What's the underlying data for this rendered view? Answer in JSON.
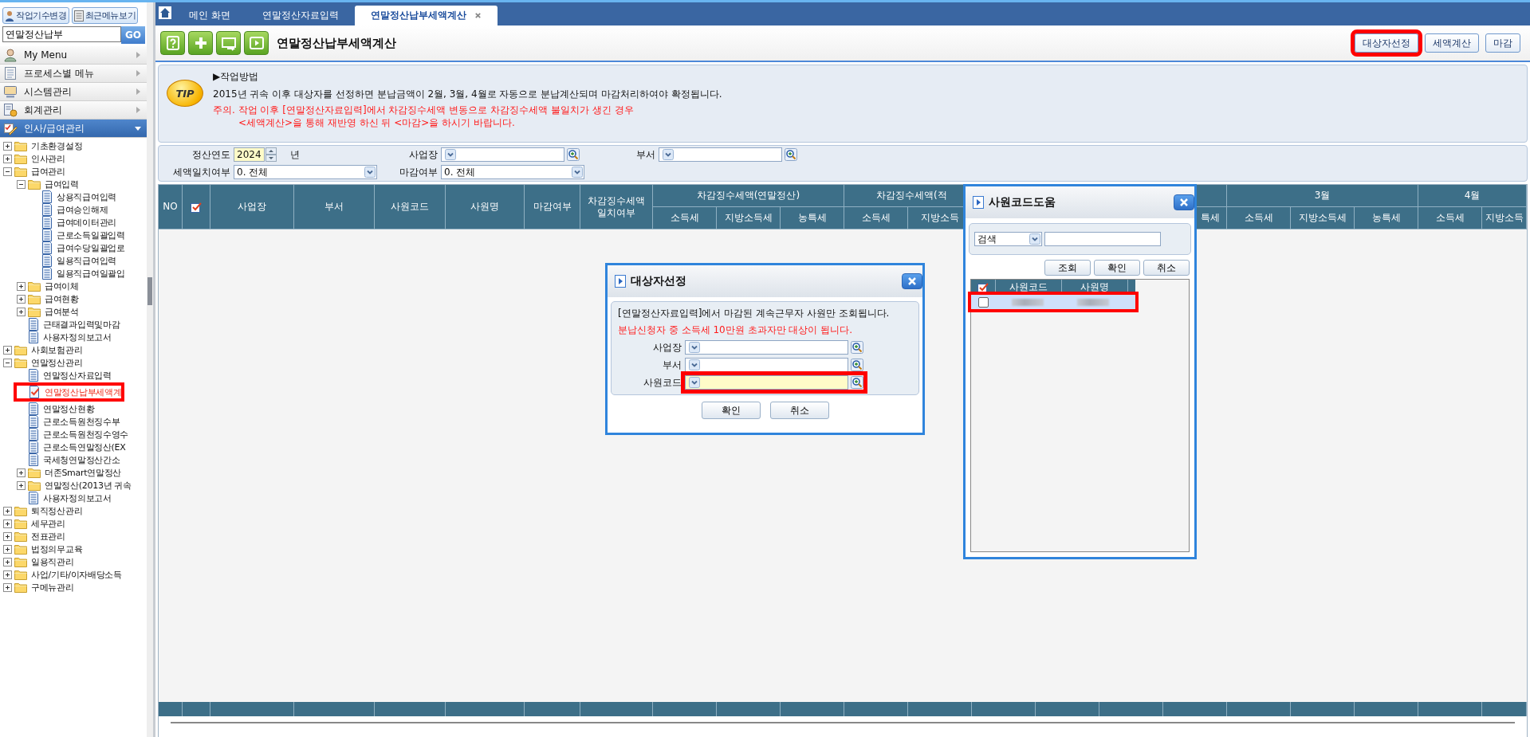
{
  "sidebar": {
    "buttons": [
      {
        "label": "작업기수변경"
      },
      {
        "label": "최근메뉴보기"
      }
    ],
    "search": {
      "value": "연말정산납부",
      "button": "GO"
    },
    "menus": [
      {
        "label": "My Menu",
        "expanded": false
      },
      {
        "label": "프로세스별 메뉴",
        "expanded": false
      },
      {
        "label": "시스템관리",
        "expanded": false
      },
      {
        "label": "회계관리",
        "expanded": false
      },
      {
        "label": "인사/급여관리",
        "expanded": true
      }
    ],
    "tree": [
      {
        "label": "기초환경설정",
        "kind": "folder",
        "expanded": false,
        "selected": false
      },
      {
        "label": "인사관리",
        "kind": "folder",
        "expanded": false,
        "selected": false
      },
      {
        "label": "급여관리",
        "kind": "folder",
        "expanded": true,
        "selected": false,
        "children": [
          {
            "label": "급여입력",
            "kind": "folder",
            "expanded": true,
            "selected": false,
            "children": [
              {
                "label": "상용직급여입력",
                "kind": "doc",
                "selected": false
              },
              {
                "label": "급여승인해제",
                "kind": "doc",
                "selected": false
              },
              {
                "label": "급여데이터관리",
                "kind": "doc",
                "selected": false
              },
              {
                "label": "근로소득일괄입력",
                "kind": "doc",
                "selected": false
              },
              {
                "label": "급여수당일괄업로",
                "kind": "doc",
                "selected": false
              },
              {
                "label": "일용직급여입력",
                "kind": "doc",
                "selected": false
              },
              {
                "label": "일용직급여일괄입",
                "kind": "doc",
                "selected": false
              }
            ]
          },
          {
            "label": "급여이체",
            "kind": "folder",
            "expanded": false,
            "selected": false
          },
          {
            "label": "급여현황",
            "kind": "folder",
            "expanded": false,
            "selected": false
          },
          {
            "label": "급여분석",
            "kind": "folder",
            "expanded": false,
            "selected": false
          },
          {
            "label": "근태결과입력및마감",
            "kind": "doc",
            "selected": false
          },
          {
            "label": "사용자정의보고서",
            "kind": "doc",
            "selected": false
          }
        ]
      },
      {
        "label": "사회보험관리",
        "kind": "folder",
        "expanded": false,
        "selected": false
      },
      {
        "label": "연말정산관리",
        "kind": "folder",
        "expanded": true,
        "selected": false,
        "children": [
          {
            "label": "연말정산자료입력",
            "kind": "doc",
            "selected": false
          },
          {
            "label": "연말정산납부세액계",
            "kind": "doc",
            "selected": true
          },
          {
            "label": "연말정산현황",
            "kind": "doc",
            "selected": false
          },
          {
            "label": "근로소득원천징수부",
            "kind": "doc",
            "selected": false
          },
          {
            "label": "근로소득원천징수영수",
            "kind": "doc",
            "selected": false
          },
          {
            "label": "근로소득연말정산(EX",
            "kind": "doc",
            "selected": false
          },
          {
            "label": "국세청연말정산간소",
            "kind": "doc",
            "selected": false
          },
          {
            "label": "더존Smart연말정산",
            "kind": "folder",
            "expanded": false,
            "selected": false
          },
          {
            "label": "연말정산(2013년 귀속",
            "kind": "folder",
            "expanded": false,
            "selected": false
          },
          {
            "label": "사용자정의보고서",
            "kind": "doc",
            "selected": false
          }
        ]
      },
      {
        "label": "퇴직정산관리",
        "kind": "folder",
        "expanded": false,
        "selected": false
      },
      {
        "label": "세무관리",
        "kind": "folder",
        "expanded": false,
        "selected": false
      },
      {
        "label": "전표관리",
        "kind": "folder",
        "expanded": false,
        "selected": false
      },
      {
        "label": "법정의무교육",
        "kind": "folder",
        "expanded": false,
        "selected": false
      },
      {
        "label": "일용직관리",
        "kind": "folder",
        "expanded": false,
        "selected": false
      },
      {
        "label": "사업/기타/이자배당소득",
        "kind": "folder",
        "expanded": false,
        "selected": false
      },
      {
        "label": "구메뉴관리",
        "kind": "folder",
        "expanded": false,
        "selected": false
      }
    ]
  },
  "tabs": [
    {
      "label": "메인 화면",
      "selected": false
    },
    {
      "label": "연말정산자료입력",
      "selected": false
    },
    {
      "label": "연말정산납부세액계산",
      "selected": true
    }
  ],
  "page": {
    "title": "연말정산납부세액계산",
    "actions": [
      {
        "label": "대상자선정",
        "highlighted": true
      },
      {
        "label": "세액계산",
        "highlighted": false
      },
      {
        "label": "마감",
        "highlighted": false
      }
    ]
  },
  "tip": {
    "badge": "TIP",
    "heading": "▶작업방법",
    "lines": [
      {
        "text": "2015년 귀속 이후 대상자를 선정하면 분납금액이 2월, 3월, 4월로 자동으로 분납계산되며 마감처리하여야 확정됩니다.",
        "kind": "info"
      },
      {
        "text": "주의. 작업 이후 [연말정산자료입력]에서 차감징수세액 변동으로 차감징수세액 불일치가 생긴 경우",
        "kind": "warning"
      },
      {
        "text": "<세액계산>을 통해 재반영 하신 뒤 <마감>을 하시기 바랍니다.",
        "kind": "warning"
      }
    ]
  },
  "filters": [
    {
      "label": "정산연도",
      "kind": "spinner",
      "value": "2024",
      "unit": "년"
    },
    {
      "label": "사업장",
      "kind": "lookup"
    },
    {
      "label": "부서",
      "kind": "lookup"
    },
    {
      "label": "세액일치여부",
      "kind": "select",
      "value": "0. 전체"
    },
    {
      "label": "마감여부",
      "kind": "select",
      "value": "0. 전체"
    }
  ],
  "table": {
    "columns": [
      {
        "kind": "text",
        "label": "NO"
      },
      {
        "kind": "check"
      },
      {
        "kind": "text",
        "label": "사업장"
      },
      {
        "kind": "text",
        "label": "부서"
      },
      {
        "kind": "text",
        "label": "사원코드"
      },
      {
        "kind": "text",
        "label": "사원명"
      },
      {
        "kind": "text",
        "label": "마감여부"
      },
      {
        "kind": "text",
        "label": "차감징수세액 일치여부"
      }
    ],
    "groups": [
      {
        "label": "차감징수세액(연말정산)",
        "subs": [
          {
            "label": "소득세"
          },
          {
            "label": "지방소득세"
          },
          {
            "label": "농특세"
          }
        ]
      },
      {
        "label": "차감징수세액(적",
        "subs": [
          {
            "label": "소득세"
          },
          {
            "label": "지방소득"
          }
        ]
      },
      {
        "subs": [
          {
            "label": "특세"
          }
        ]
      },
      {
        "label": "3월",
        "subs": [
          {
            "label": "소득세"
          },
          {
            "label": "지방소득세"
          },
          {
            "label": "농특세"
          }
        ]
      },
      {
        "label": "4월",
        "subs": [
          {
            "label": "소득세"
          },
          {
            "label": "지방소득"
          }
        ]
      }
    ]
  },
  "dialogs": [
    {
      "kind": "target",
      "title": "대상자선정",
      "notes": [
        {
          "text": "[연말정산자료입력]에서 마감된 계속근무자 사원만 조회됩니다.",
          "kind": "info"
        },
        {
          "text": "분납신청자 중 소득세 10만원 초과자만 대상이 됩니다.",
          "kind": "warning"
        }
      ],
      "fields": [
        {
          "label": "사업장",
          "required": false,
          "highlighted": false
        },
        {
          "label": "부서",
          "required": false,
          "highlighted": false
        },
        {
          "label": "사원코드",
          "required": true,
          "highlighted": true
        }
      ],
      "buttons": [
        {
          "label": "확인"
        },
        {
          "label": "취소"
        }
      ]
    },
    {
      "kind": "help",
      "title": "사원코드도움",
      "search": {
        "option": "검색"
      },
      "buttons": [
        {
          "label": "조회"
        },
        {
          "label": "확인"
        },
        {
          "label": "취소"
        }
      ],
      "columns": [
        {
          "kind": "check"
        },
        {
          "kind": "text",
          "label": "사원코드"
        },
        {
          "kind": "text",
          "label": "사원명"
        }
      ],
      "rows": [
        {
          "checked": false,
          "selected": true,
          "highlighted": true
        }
      ]
    }
  ]
}
